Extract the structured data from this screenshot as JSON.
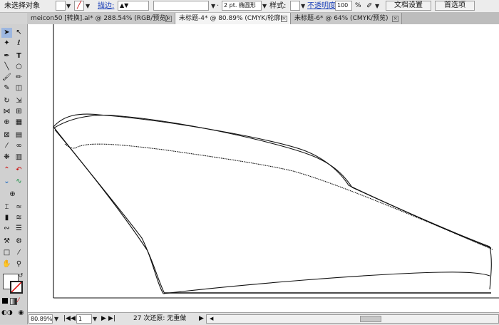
{
  "control_bar": {
    "selection_status": "未选择对象",
    "stroke_label": "描边:",
    "brush_value": "2 pt. 椭圆形",
    "style_label": "样式:",
    "opacity_label": "不透明度:",
    "opacity_value": "100",
    "percent": "%",
    "doc_setup_button": "文档设置",
    "preferences_button": "首选项"
  },
  "tabs": [
    {
      "label": "meicon50 [转换].ai* @ 288.54% (RGB/预览)",
      "active": false
    },
    {
      "label": "未标题-4* @ 80.89% (CMYK/轮廓)",
      "active": true
    },
    {
      "label": "未标题-6* @ 64% (CMYK/预览)",
      "active": false
    }
  ],
  "status_bar": {
    "zoom": "80.89%",
    "page": "1",
    "undo_info": "27 次还原: 无重做"
  },
  "colors": {
    "accent_link": "#1a3fb8",
    "canvas": "#ffffff",
    "ui_bg": "#d4d4d4"
  }
}
